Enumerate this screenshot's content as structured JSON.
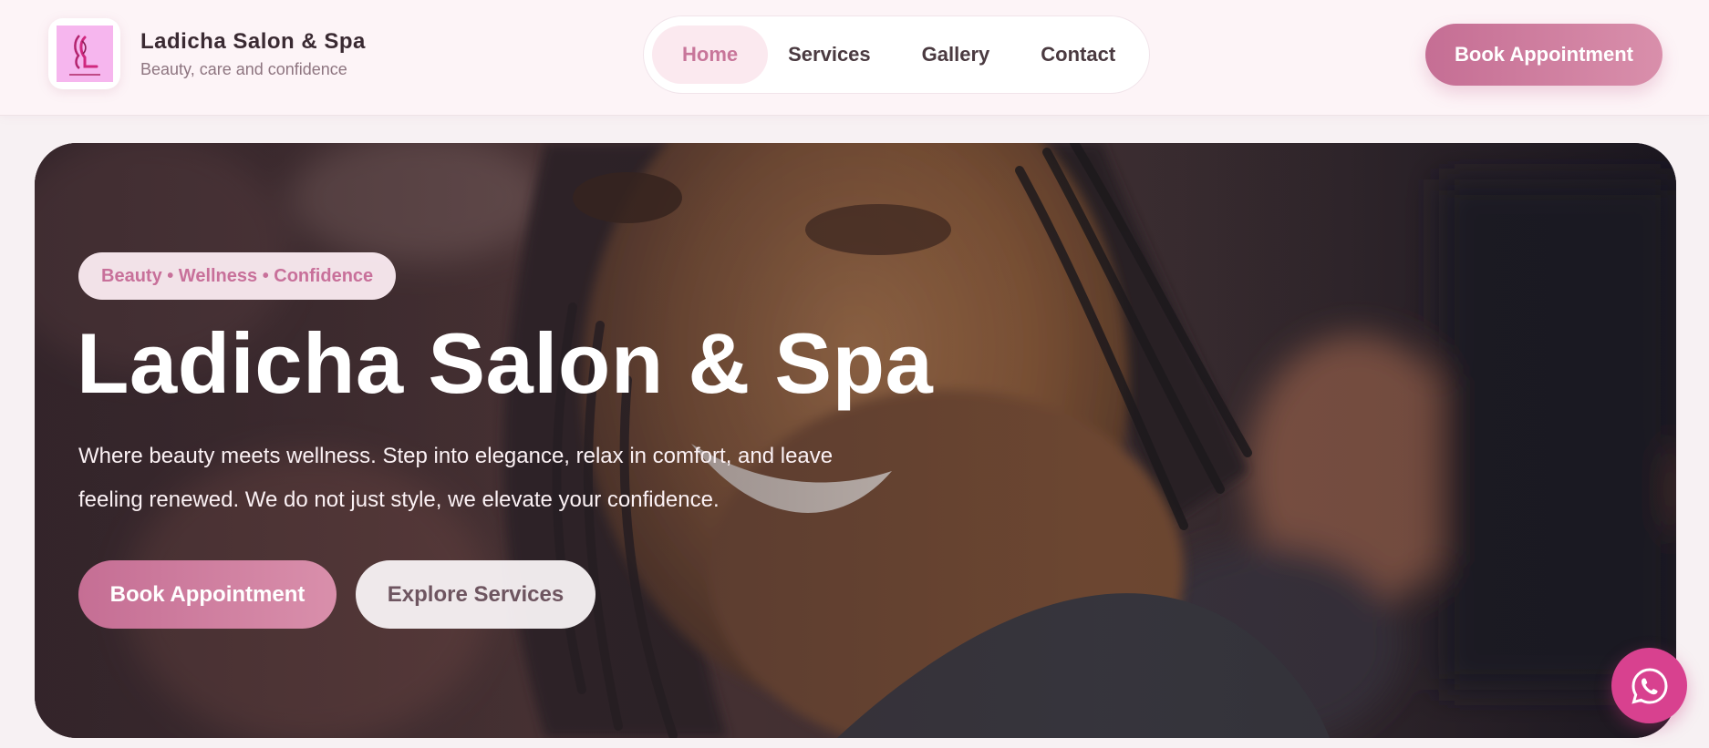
{
  "brand": {
    "name": "Ladicha Salon & Spa",
    "tagline": "Beauty, care and confidence",
    "logo_icon": "salon-logo-icon"
  },
  "nav": {
    "items": [
      {
        "label": "Home",
        "active": true
      },
      {
        "label": "Services",
        "active": false
      },
      {
        "label": "Gallery",
        "active": false
      },
      {
        "label": "Contact",
        "active": false
      }
    ]
  },
  "header": {
    "cta_label": "Book Appointment"
  },
  "hero": {
    "badge": "Beauty • Wellness • Confidence",
    "title": "Ladicha Salon & Spa",
    "description": "Where beauty meets wellness. Step into elegance, relax in comfort, and leave feeling renewed. We do not just style, we elevate your confidence.",
    "primary_cta": "Book Appointment",
    "secondary_cta": "Explore Services"
  },
  "floating": {
    "whatsapp_icon": "whatsapp-icon"
  },
  "colors": {
    "accent": "#c8769a",
    "accent_gradient_start": "#c56e94",
    "accent_gradient_end": "#d98fab",
    "whatsapp": "#d8418f",
    "header_bg": "#fdf4f7",
    "page_bg": "#f7f1f3"
  }
}
